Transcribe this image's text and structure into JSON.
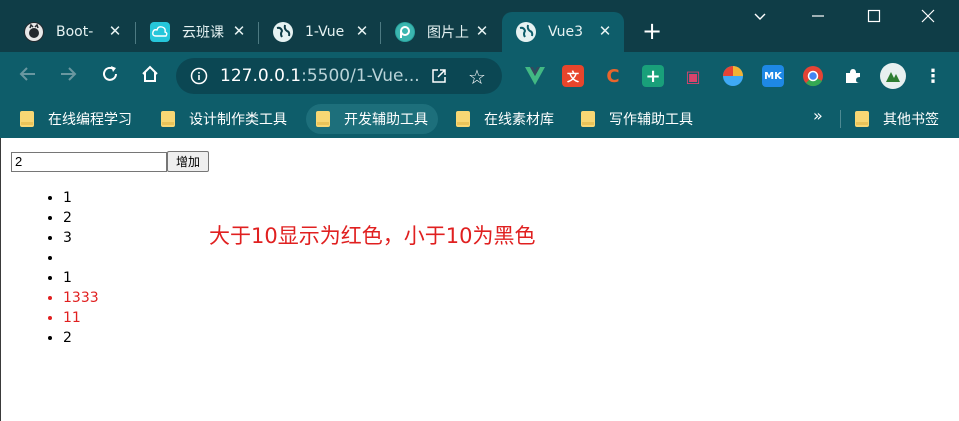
{
  "browser": {
    "tabs": [
      {
        "label": "Boot-",
        "icon": "github-icon"
      },
      {
        "label": "云班课",
        "icon": "cloud-class-icon"
      },
      {
        "label": "1-Vue",
        "icon": "globe-icon"
      },
      {
        "label": "图片上",
        "icon": "p-logo-icon"
      },
      {
        "label": "Vue3",
        "icon": "globe-icon"
      }
    ],
    "active_tab_index": 4,
    "address": {
      "host": "127.0.0.1",
      "path": ":5500/1-Vue..."
    },
    "extensions": [
      {
        "name": "vue-devtools-icon",
        "color": "#42b883",
        "glyph": "V"
      },
      {
        "name": "translate-ext-icon",
        "color": "#e8452c",
        "glyph": "文"
      },
      {
        "name": "c-ext-icon",
        "color": "#e8652c",
        "glyph": "C"
      },
      {
        "name": "plus-ext-icon",
        "color": "#19a07a",
        "glyph": "+"
      },
      {
        "name": "tv-ext-icon",
        "color": "#d9446c",
        "glyph": "▣"
      },
      {
        "name": "color-ext-icon",
        "color": "#f2b233",
        "glyph": "●"
      },
      {
        "name": "mk-ext-icon",
        "color": "#1e88e5",
        "glyph": "MK"
      },
      {
        "name": "chrome-ext-icon",
        "color": "#e54335",
        "glyph": "◎"
      }
    ],
    "bookmarks": [
      "在线编程学习",
      "设计制作类工具",
      "开发辅助工具",
      "在线素材库",
      "写作辅助工具"
    ],
    "bookmark_more": "»",
    "other_bookmarks": "其他书签"
  },
  "page": {
    "input_value": "2",
    "add_button_label": "增加",
    "items": [
      {
        "text": "1",
        "color": "#000000"
      },
      {
        "text": "2",
        "color": "#000000"
      },
      {
        "text": "3",
        "color": "#000000"
      },
      {
        "text": "",
        "color": "#000000"
      },
      {
        "text": "1",
        "color": "#000000"
      },
      {
        "text": "1333",
        "color": "#e02020"
      },
      {
        "text": "11",
        "color": "#e02020"
      },
      {
        "text": "2",
        "color": "#000000"
      }
    ],
    "note": "大于10显示为红色，小于10为黑色"
  }
}
